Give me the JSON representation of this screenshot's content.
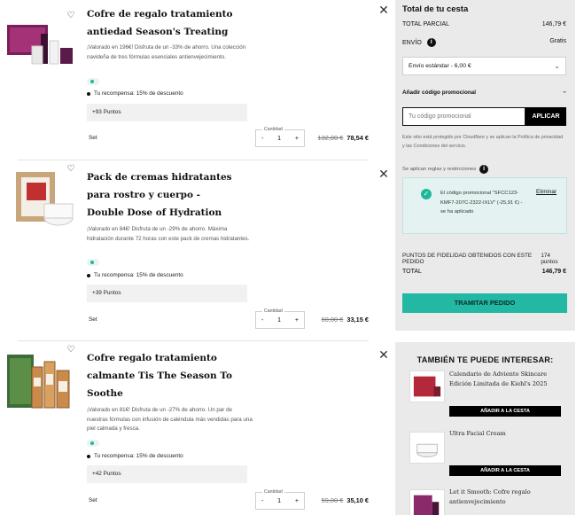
{
  "cart": {
    "items": [
      {
        "title": "Cofre de regalo tratamiento antiedad Season's Treating",
        "description": "¡Valorado en 196€! Disfruta de un -33% de ahorro. Una colección navideña de tres fórmulas esenciales antienvejecimiento.",
        "reward": "Tu recompensa: 15% de descuento",
        "points": "+93 Puntos",
        "variant": "Set",
        "qty_label": "Cantidad",
        "qty": "1",
        "price_old": "132,00 €",
        "price_new": "78,54 €"
      },
      {
        "title": "Pack de cremas hidratantes para rostro y cuerpo - Double Dose of Hydration",
        "description": "¡Valorado en 84€! Disfruta de un -29% de ahorro. Máxima hidratación durante 72 horas con este pack de cremas hidratantes.",
        "reward": "Tu recompensa: 15% de descuento",
        "points": "+39 Puntos",
        "variant": "Set",
        "qty_label": "Cantidad",
        "qty": "1",
        "price_old": "60,00 €",
        "price_new": "33,15 €"
      },
      {
        "title": "Cofre regalo tratamiento calmante Tis The Season To Soothe",
        "description": "¡Valorado en 81€! Disfruta de un -27% de ahorro. Un par de nuestras fórmulas con infusión de caléndula más vendidas para una piel calmada y fresca.",
        "reward": "Tu recompensa: 15% de descuento",
        "points": "+42 Puntos",
        "variant": "Set",
        "qty_label": "Cantidad",
        "qty": "1",
        "price_old": "59,00 €",
        "price_new": "35,10 €"
      }
    ],
    "qty_minus": "-",
    "qty_plus": "+"
  },
  "summary": {
    "title": "Total de tu cesta",
    "subtotal_label": "TOTAL PARCIAL",
    "subtotal_value": "146,79 €",
    "shipping_label": "ENVÍO",
    "shipping_value": "Gratis",
    "shipping_option": "Envío estándar - 6,00 €",
    "promo_heading": "Añadir código promocional",
    "promo_toggle": "−",
    "promo_placeholder": "Tu código promocional",
    "promo_apply": "APLICAR",
    "legal": "Este sitio está protegido por Cloudflare y se aplican la Política de privacidad y las Condiciones del servicio.",
    "rules": "Se aplican reglas y restricciones",
    "applied_text": "El código promocional \"SFCC123-KMF7-207C-2322-IXLV\" (-25,91 €) - se ha aplicado",
    "remove": "Eliminar",
    "loyalty_label": "PUNTOS DE FIDELIDAD OBTENIDOS CON ESTE PEDIDO",
    "loyalty_value": "174 puntos",
    "total_label": "TOTAL",
    "total_value": "146,79 €",
    "checkout": "TRAMITAR PEDIDO",
    "info_glyph": "i"
  },
  "recommendations": {
    "title": "TAMBIÉN TE PUEDE INTERESAR:",
    "items": [
      {
        "name": "Calendario de Adviento Skincare Edición Limitada de Kiehl's 2025",
        "button": "AÑADIR A LA CESTA"
      },
      {
        "name": "Ultra Facial Cream",
        "button": "AÑADIR A LA CESTA"
      },
      {
        "name": "Let it Smooth: Cofre regalo antienvejecimiento"
      }
    ]
  },
  "colors": {
    "accent_teal": "#22b8a3",
    "panel_gray": "#eaeaea",
    "applied_bg": "#e4f3f1"
  },
  "icons": {
    "heart": "heart-icon",
    "close": "close-icon",
    "info": "info-icon",
    "check": "check-icon",
    "chevron": "chevron-down-icon"
  }
}
